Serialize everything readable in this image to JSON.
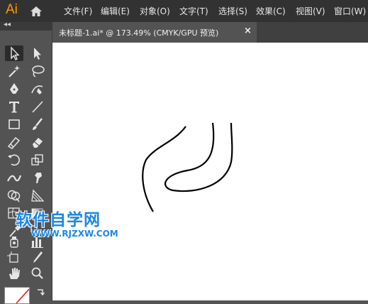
{
  "app": {
    "logo_text": "Ai"
  },
  "menu": {
    "items": [
      "文件(F)",
      "编辑(E)",
      "对象(O)",
      "文字(T)",
      "选择(S)",
      "效果(C)",
      "视图(V)",
      "窗口(W)"
    ]
  },
  "document_tab": {
    "title": "未标题-1.ai* @ 173.49% (CMYK/GPU 预览)",
    "close_glyph": "×"
  },
  "toolbar": {
    "collapse_glyph": "◂◂",
    "tools": [
      "selection-tool",
      "direct-selection-tool",
      "magic-wand-tool",
      "lasso-tool",
      "pen-tool",
      "curvature-tool",
      "type-tool",
      "line-segment-tool",
      "rectangle-tool",
      "paintbrush-tool",
      "shaper-tool",
      "eraser-tool",
      "rotate-tool",
      "scale-tool",
      "width-tool",
      "puppet-warp-tool",
      "shape-builder-tool",
      "perspective-grid-tool",
      "mesh-tool",
      "gradient-tool",
      "eyedropper-tool",
      "blend-tool",
      "symbol-sprayer-tool",
      "column-graph-tool",
      "artboard-tool",
      "slice-tool",
      "hand-tool",
      "zoom-tool"
    ],
    "selected_tool": "selection-tool"
  },
  "colors": {
    "accent_logo": "#ff9a00",
    "menubar_bg": "#323232",
    "panel_bg": "#535353",
    "canvas_bg": "#ffffff",
    "stroke": "#000000",
    "watermark": "#1a87e8"
  },
  "watermark": {
    "title": "软件自学网",
    "url": "WWW.RJZXW.COM"
  }
}
